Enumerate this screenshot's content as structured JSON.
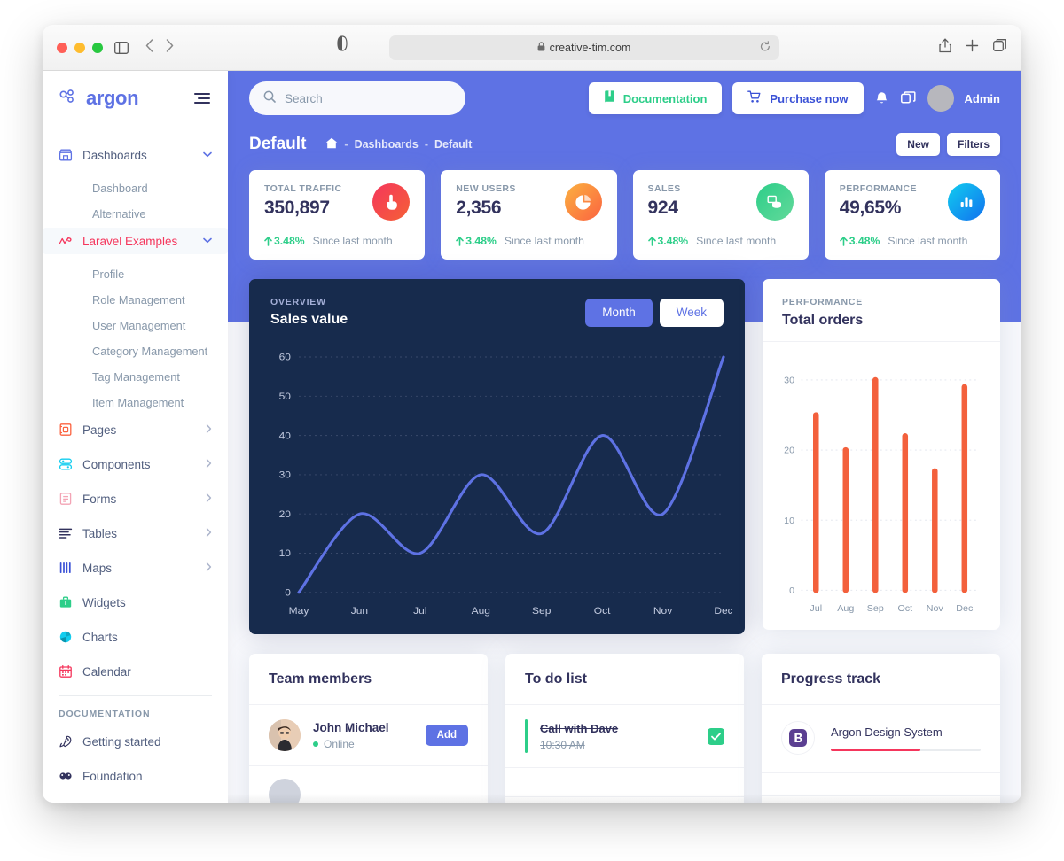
{
  "browser": {
    "url": "creative-tim.com",
    "lock_icon": "lock-icon",
    "reload_icon": "reload-icon",
    "sidebar_toggle_icon": "sidebar-toggle-icon",
    "back_icon": "back-arrow-icon",
    "forward_icon": "forward-arrow-icon",
    "shield_icon": "privacy-shield-icon",
    "share_icon": "share-icon",
    "newtab_icon": "new-tab-icon",
    "tabs_icon": "tab-overview-icon"
  },
  "sidebar": {
    "brand": "argon",
    "brand_icon": "argon-logo-icon",
    "menu_icon": "hamburger-icon",
    "items": [
      {
        "label": "Dashboards",
        "icon": "store-icon",
        "chevron": "chevron-down",
        "active": false,
        "type": "group"
      },
      {
        "label": "Dashboard",
        "type": "sub"
      },
      {
        "label": "Alternative",
        "type": "sub"
      },
      {
        "label": "Laravel Examples",
        "icon": "laravel-icon",
        "chevron": "chevron-down",
        "active": true,
        "type": "group"
      },
      {
        "label": "Profile",
        "type": "sub"
      },
      {
        "label": "Role Management",
        "type": "sub"
      },
      {
        "label": "User Management",
        "type": "sub"
      },
      {
        "label": "Category Management",
        "type": "sub"
      },
      {
        "label": "Tag Management",
        "type": "sub"
      },
      {
        "label": "Item Management",
        "type": "sub"
      },
      {
        "label": "Pages",
        "icon": "pages-icon",
        "chevron": "chevron-right",
        "active": false,
        "type": "group"
      },
      {
        "label": "Components",
        "icon": "components-icon",
        "chevron": "chevron-right",
        "active": false,
        "type": "group"
      },
      {
        "label": "Forms",
        "icon": "forms-icon",
        "chevron": "chevron-right",
        "active": false,
        "type": "group"
      },
      {
        "label": "Tables",
        "icon": "tables-icon",
        "chevron": "chevron-right",
        "active": false,
        "type": "group"
      },
      {
        "label": "Maps",
        "icon": "maps-icon",
        "chevron": "chevron-right",
        "active": false,
        "type": "group"
      },
      {
        "label": "Widgets",
        "icon": "widgets-icon",
        "active": false,
        "type": "group"
      },
      {
        "label": "Charts",
        "icon": "charts-icon",
        "active": false,
        "type": "group"
      },
      {
        "label": "Calendar",
        "icon": "calendar-icon",
        "active": false,
        "type": "group"
      }
    ],
    "section_label": "DOCUMENTATION",
    "doc_items": [
      {
        "label": "Getting started",
        "icon": "rocket-icon"
      },
      {
        "label": "Foundation",
        "icon": "foundation-icon"
      }
    ]
  },
  "topnav": {
    "search_placeholder": "Search",
    "search_value": "",
    "search_icon": "search-icon",
    "documentation_label": "Documentation",
    "documentation_icon": "book-icon",
    "purchase_label": "Purchase now",
    "purchase_icon": "cart-icon",
    "bell_icon": "bell-icon",
    "apps_icon": "apps-icon",
    "avatar": "user-avatar",
    "user_name": "Admin"
  },
  "pagehead": {
    "title": "Default",
    "home_icon": "home-icon",
    "breadcrumb": [
      "Dashboards",
      "Default"
    ],
    "separator": "-",
    "new_label": "New",
    "filters_label": "Filters"
  },
  "stats": [
    {
      "label": "TOTAL TRAFFIC",
      "value": "350,897",
      "icon": "hand-pointer-icon",
      "color_from": "#f5365c",
      "color_to": "#f56036",
      "delta": "3.48%",
      "delta_dir": "up",
      "since": "Since last month"
    },
    {
      "label": "NEW USERS",
      "value": "2,356",
      "icon": "pie-chart-icon",
      "color_from": "#fb6340",
      "color_to": "#fbb140",
      "delta": "3.48%",
      "delta_dir": "up",
      "since": "Since last month"
    },
    {
      "label": "SALES",
      "value": "924",
      "icon": "money-coins-icon",
      "color_from": "#2dce89",
      "color_to": "#62d99a",
      "delta": "3.48%",
      "delta_dir": "up",
      "since": "Since last month"
    },
    {
      "label": "PERFORMANCE",
      "value": "49,65%",
      "icon": "bar-chart-icon",
      "color_from": "#11cdef",
      "color_to": "#1171ef",
      "delta": "3.48%",
      "delta_dir": "up",
      "since": "Since last month"
    }
  ],
  "sales_card": {
    "eyebrow": "OVERVIEW",
    "title": "Sales value",
    "buttons": [
      {
        "label": "Month",
        "selected": true
      },
      {
        "label": "Week",
        "selected": false
      }
    ]
  },
  "orders_card": {
    "eyebrow": "PERFORMANCE",
    "title": "Total orders"
  },
  "chart_data": [
    {
      "type": "line",
      "title": "Sales value",
      "subtitle": "OVERVIEW",
      "categories": [
        "May",
        "Jun",
        "Jul",
        "Aug",
        "Sep",
        "Oct",
        "Nov",
        "Dec"
      ],
      "values": [
        0,
        20,
        10,
        30,
        15,
        40,
        20,
        60
      ],
      "series": [
        {
          "name": "Sales",
          "values": [
            0,
            20,
            10,
            30,
            15,
            40,
            20,
            60
          ]
        }
      ],
      "yticks": [
        0,
        10,
        20,
        30,
        40,
        50,
        60
      ],
      "ylim": [
        0,
        60
      ],
      "xlabel": "",
      "ylabel": "",
      "grid": true,
      "legend": "none",
      "line_color": "#5e72e4",
      "background": "#172b4d"
    },
    {
      "type": "bar",
      "title": "Total orders",
      "subtitle": "PERFORMANCE",
      "categories": [
        "Jul",
        "Aug",
        "Sep",
        "Oct",
        "Nov",
        "Dec"
      ],
      "values": [
        25,
        20,
        30,
        22,
        17,
        29
      ],
      "yticks": [
        0,
        10,
        20,
        30
      ],
      "ylim": [
        0,
        32
      ],
      "xlabel": "",
      "ylabel": "",
      "grid": true,
      "legend": "none",
      "bar_color": "#f3603c",
      "background": "#ffffff"
    }
  ],
  "team": {
    "title": "Team members",
    "members": [
      {
        "name": "John Michael",
        "status": "Online",
        "status_color": "#2dce89",
        "action": "Add"
      }
    ]
  },
  "todo": {
    "title": "To do list",
    "items": [
      {
        "text": "Call with Dave",
        "time": "10:30 AM",
        "done": true,
        "accent": "#2dce89"
      }
    ]
  },
  "progress": {
    "title": "Progress track",
    "items": [
      {
        "name": "Argon Design System",
        "icon": "bootstrap-icon",
        "percent": 60,
        "color": "#f5365c"
      }
    ]
  }
}
